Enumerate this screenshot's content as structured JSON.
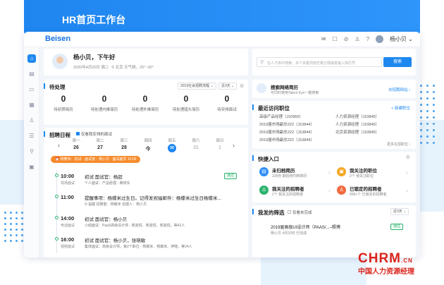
{
  "hero": {
    "title": "HR首页工作台"
  },
  "topbar": {
    "logo": "Beisen",
    "user_name": "杨小贝 ⌄",
    "icons": [
      "mail-icon",
      "message-icon",
      "compass-icon",
      "person-icon",
      "help-icon"
    ]
  },
  "sidebar": {
    "items": [
      "home-icon",
      "chart-icon",
      "monitor-icon",
      "calendar-icon",
      "user-icon",
      "document-icon",
      "user-search-icon",
      "screen-icon"
    ]
  },
  "greeting": {
    "title": "杨小贝，下午好",
    "date": "2020年4月20日  周二",
    "weather": "北京  天气晴，25°~30°"
  },
  "search": {
    "placeholder": "在人才库中搜索，多个关键词用空格分隔或者输入简历号",
    "button": "搜索"
  },
  "todo": {
    "title": "待处理",
    "filter1": "2019社会招聘流程 ⌄",
    "filter2": "近3天 ⌄",
    "items": [
      {
        "count": "0",
        "label": "待初筛简历"
      },
      {
        "count": "0",
        "label": "待处理内推简历"
      },
      {
        "count": "0",
        "label": "待处理外推简历"
      },
      {
        "count": "0",
        "label": "待处理猎头简历"
      },
      {
        "count": "0",
        "label": "待安排面试"
      }
    ]
  },
  "network": {
    "title": "搜索网络简历",
    "subtitle": "可同时使用Talent Eye一键搜索",
    "link": "去招聘网站 ›"
  },
  "schedule": {
    "title": "招聘日程",
    "checkbox_label": "仅看我安排的面试",
    "weekdays": [
      "周一",
      "周二",
      "周三",
      "周四",
      "周五",
      "周六",
      "周日"
    ],
    "days": [
      "26",
      "27",
      "28",
      "今",
      "30",
      "31",
      "1"
    ],
    "alert": "杨樊米：初试 · 面试官：杨小贝 · 面试差异 10:00",
    "events": [
      {
        "time": "10:00",
        "type": "现场面试",
        "title": "初试   面试官：杨超",
        "detail": "个人面试：产品经理 - 冀晓东",
        "status": "通过"
      },
      {
        "time": "11:00",
        "type": "",
        "title": "提醒事项：杨蝶米过生日。记得发祝福邮件：杨蝶米过生日杨蝶米...",
        "detail": "⏱ 提醒   招聘者：杨蝶米    创建人：杨小贝",
        "status": ""
      },
      {
        "time": "14:00",
        "type": "电话面试",
        "title": "初试   面试官：杨小贝",
        "detail": "小组面试：PaaS高级设计师 - 吴其悦、吴其悦、吴其悦，等42人",
        "status": ""
      },
      {
        "time": "16:00",
        "type": "视频面试",
        "title": "初试   面试官：杨小贝，张晓敏",
        "detail": "集体面试：高级设计师，第2个职位 - 杨蝶米、杨蝶米、伊隆，等24人",
        "status": ""
      }
    ]
  },
  "recent": {
    "title": "最近访问职位",
    "new_button": "+ 新建职位",
    "rows": [
      [
        "高级产品经理（J10966）",
        "人力资源经理（J10845）"
      ],
      [
        "2019届市场副总222（J10844）",
        "人力资源经理（J10845）"
      ],
      [
        "2019届市场副总222（J10844）",
        "北京资源经理（J10845）"
      ],
      [
        "2019届市场副总222（J10844）",
        ""
      ]
    ],
    "more": "更多在招职位 ›"
  },
  "quick": {
    "title": "快捷入口",
    "items": [
      {
        "title": "未归档简历",
        "sub": "228份  期招待归档简历",
        "color": "#2e8ef5"
      },
      {
        "title": "我关注的职位",
        "sub": "2个  我关注职位",
        "color": "#f5a623"
      },
      {
        "title": "我关注的招聘者",
        "sub": "2个  我关注的招聘者",
        "color": "#2db36f"
      },
      {
        "title": "已锁定的招聘者",
        "sub": "999+个  已锁定的招聘者",
        "color": "#f06b3f"
      }
    ]
  },
  "filter": {
    "title": "我发的筛选",
    "checkbox_label": "仅看未完成",
    "select": "近3天 ⌄",
    "item_title": "2019届高级UI设计师（PAAS/...–照博",
    "item_meta": "杨小贝   4月20日   已完成",
    "status": "通过"
  },
  "watermark": {
    "brand": "CHRM",
    "suffix": ".CN",
    "sub": "中国人力资源经理"
  }
}
